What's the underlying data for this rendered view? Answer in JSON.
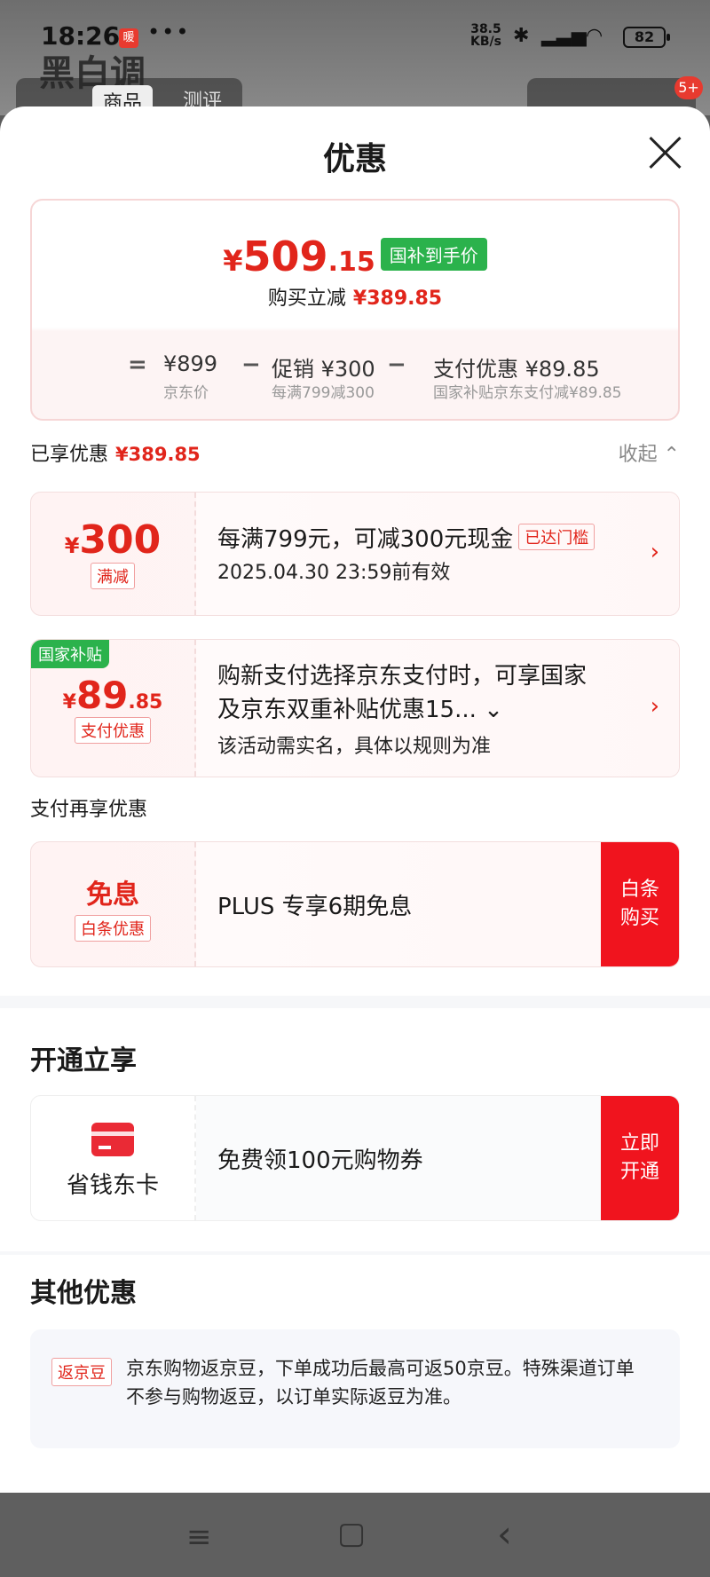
{
  "status": {
    "time": "18:26",
    "badge": "暖",
    "dots": "•••",
    "speed_top": "38.5",
    "speed_bottom": "KB/s",
    "battery": "82"
  },
  "background": {
    "logo": "黑白调",
    "tabs": [
      "商品",
      "测评"
    ],
    "cart_badge": "5+"
  },
  "sheet": {
    "title": "优惠"
  },
  "summary": {
    "yen": "¥",
    "price_main": "509",
    "price_dec": ".15",
    "price_tag": "国补到手价",
    "sub_label": "购买立减",
    "sub_amount": "¥389.85",
    "breakdown": [
      {
        "op": "=",
        "value": "¥899",
        "label": "京东价"
      },
      {
        "op": "−",
        "value": "促销 ¥300",
        "label": "每满799减300"
      },
      {
        "op": "−",
        "value": "支付优惠 ¥89.85",
        "label": "国家补贴京东支付减¥89.85"
      }
    ]
  },
  "enjoyed": {
    "label": "已享优惠",
    "amount": "¥389.85",
    "collapse": "收起 ⌃"
  },
  "coupons": [
    {
      "yen": "¥",
      "amount": "300",
      "tag": "满减",
      "main": "每满799元，可减300元现金",
      "status": "已达门槛",
      "sub": "2025.04.30 23:59前有效",
      "arrow": "›"
    },
    {
      "corner": "国家补贴",
      "yen": "¥",
      "amount": "89",
      "dec": ".85",
      "tag": "支付优惠",
      "line1": "购新支付选择京东支付时，可享国家",
      "line2": "及京东双重补贴优惠15... ⌄",
      "sub": "该活动需实名，具体以规则为准",
      "arrow": "›"
    }
  ],
  "pay_more": {
    "title": "支付再享优惠",
    "amount": "免息",
    "tag": "白条优惠",
    "main": "PLUS 专享6期免息",
    "action_line1": "白条",
    "action_line2": "购买"
  },
  "open": {
    "title": "开通立享",
    "card_name": "省钱东卡",
    "main": "免费领100元购物券",
    "action_line1": "立即",
    "action_line2": "开通"
  },
  "other": {
    "title": "其他优惠",
    "tag": "返京豆",
    "text": "京东购物返京豆，下单成功后最高可返50京豆。特殊渠道订单不参与购物返豆，以订单实际返豆为准。"
  },
  "nav": {
    "menu": "≡",
    "home": "▢",
    "back": "‹"
  },
  "colors": {
    "accent_red": "#e1251b",
    "action_red": "#f0141e",
    "subsidy_green": "#2bb24c"
  }
}
